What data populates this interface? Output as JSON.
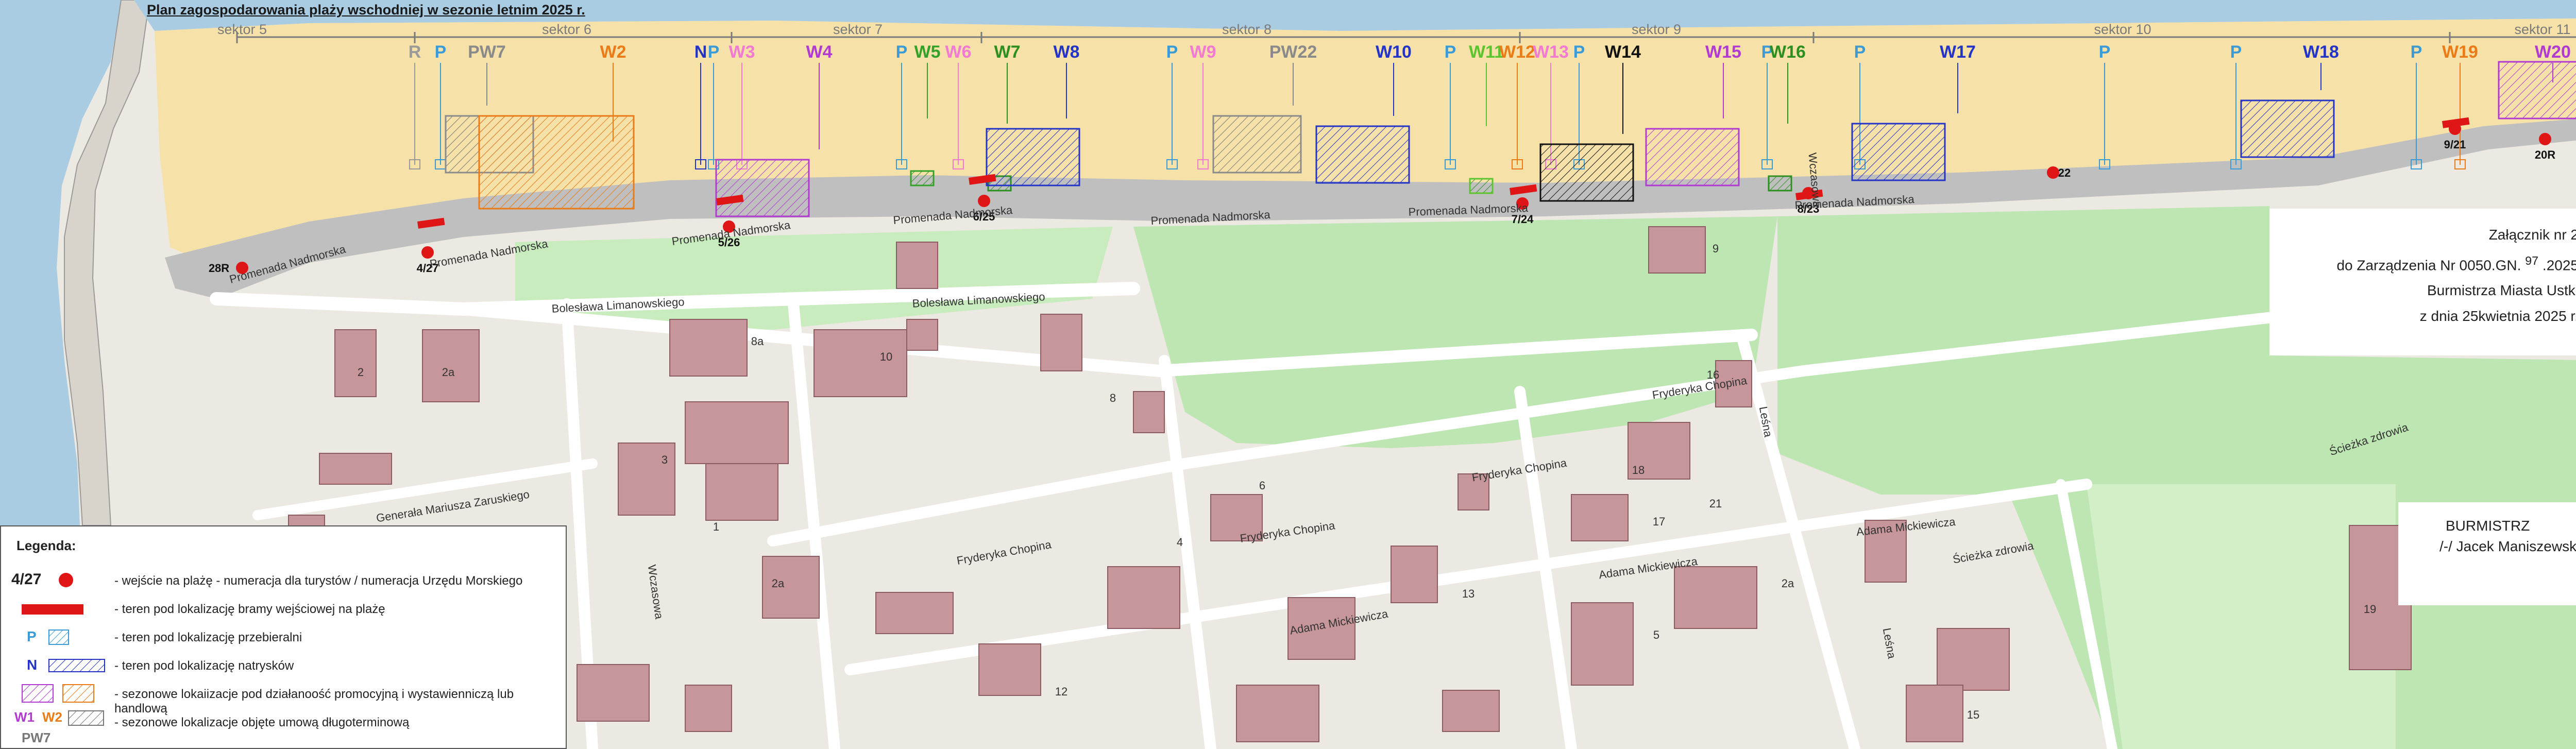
{
  "title": "Plan zagospodarowania plaży wschodniej w sezonie letnim 2025 r.",
  "colors": {
    "sea": "#a9cce3",
    "sand": "#f6e2a9",
    "promenade": "#bfbfbf",
    "park": "#bde6b3",
    "building": "#c6969a",
    "road": "#ffffff",
    "gate": "#e01515",
    "shower": "#2434c6",
    "lifeguard": "#3b9bd6"
  },
  "sectors": [
    "sektor 5",
    "sektor 6",
    "sektor 7",
    "sektor 8",
    "sektor 9",
    "sektor 10",
    "sektor 11"
  ],
  "lots": [
    {
      "label": "R",
      "color": "#9a9a9a",
      "kind": "point"
    },
    {
      "label": "P",
      "color": "#3b9bd6",
      "kind": "point"
    },
    {
      "label": "PW7",
      "color": "#8a8a8a",
      "kind": "long"
    },
    {
      "label": "W2",
      "color": "#ea7b16",
      "kind": "hatch"
    },
    {
      "label": "N",
      "color": "#2434c6",
      "kind": "point"
    },
    {
      "label": "P",
      "color": "#3b9bd6",
      "kind": "point"
    },
    {
      "label": "W3",
      "color": "#f27ad3",
      "kind": "point"
    },
    {
      "label": "W4",
      "color": "#b13ad1",
      "kind": "hatch"
    },
    {
      "label": "P",
      "color": "#3b9bd6",
      "kind": "point"
    },
    {
      "label": "W5",
      "color": "#34a12b",
      "kind": "small"
    },
    {
      "label": "W6",
      "color": "#f27ad3",
      "kind": "point"
    },
    {
      "label": "W7",
      "color": "#2c8f20",
      "kind": "small"
    },
    {
      "label": "W8",
      "color": "#2434c6",
      "kind": "hatch"
    },
    {
      "label": "P",
      "color": "#3b9bd6",
      "kind": "point"
    },
    {
      "label": "W9",
      "color": "#f27ad3",
      "kind": "point"
    },
    {
      "label": "PW22",
      "color": "#8a8a8a",
      "kind": "long"
    },
    {
      "label": "W10",
      "color": "#2434c6",
      "kind": "hatch"
    },
    {
      "label": "P",
      "color": "#3b9bd6",
      "kind": "point"
    },
    {
      "label": "W11",
      "color": "#5cc42e",
      "kind": "small"
    },
    {
      "label": "W12",
      "color": "#ea7b16",
      "kind": "point"
    },
    {
      "label": "W13",
      "color": "#f27ad3",
      "kind": "point"
    },
    {
      "label": "P",
      "color": "#3b9bd6",
      "kind": "point"
    },
    {
      "label": "W14",
      "color": "#111111",
      "kind": "hatch"
    },
    {
      "label": "W15",
      "color": "#b13ad1",
      "kind": "hatch"
    },
    {
      "label": "P",
      "color": "#3b9bd6",
      "kind": "point"
    },
    {
      "label": "W16",
      "color": "#2c8f20",
      "kind": "small"
    },
    {
      "label": "P",
      "color": "#3b9bd6",
      "kind": "point"
    },
    {
      "label": "W17",
      "color": "#2434c6",
      "kind": "hatch"
    },
    {
      "label": "P",
      "color": "#3b9bd6",
      "kind": "point"
    },
    {
      "label": "P",
      "color": "#3b9bd6",
      "kind": "point"
    },
    {
      "label": "W18",
      "color": "#2434c6",
      "kind": "hatch"
    },
    {
      "label": "P",
      "color": "#3b9bd6",
      "kind": "point"
    },
    {
      "label": "W19",
      "color": "#ea7b16",
      "kind": "point"
    },
    {
      "label": "W20",
      "color": "#b13ad1",
      "kind": "hatch"
    },
    {
      "label": "O",
      "color": "#e01515",
      "kind": "point"
    }
  ],
  "entrances": [
    "28R",
    "4/27",
    "5/26",
    "6/25",
    "7/24",
    "8/23",
    "22",
    "9/21",
    "20R"
  ],
  "streets": [
    "Promenada Nadmorska",
    "Promenada Nadmorska",
    "Promenada Nadmorska",
    "Promenada Nadmorska",
    "Promenada Nadmorska",
    "Promenada Nadmorska",
    "Promenada Nadmorska",
    "Bolesława Limanowskiego",
    "Bolesława Limanowskiego",
    "Fryderyka Chopina",
    "Fryderyka Chopina",
    "Fryderyka Chopina",
    "Fryderyka Chopina",
    "Adama Mickiewicza",
    "Adama Mickiewicza",
    "Adama Mickiewicza",
    "Generała Mariusza Zaruskiego",
    "Ścieżka zdrowia",
    "Ścieżka zdrowia",
    "Leśna",
    "Leśna",
    "Wczasowa",
    "Wczasowa"
  ],
  "plots": [
    "2",
    "2a",
    "8a",
    "10",
    "3",
    "1",
    "2a",
    "6",
    "13",
    "16",
    "18",
    "9",
    "2a",
    "8",
    "4",
    "12",
    "19",
    "15",
    "17",
    "21",
    "5"
  ],
  "attachment": {
    "line1": "Załącznik nr 2",
    "line2_prefix": "do Zarządzenia Nr 0050.GN.",
    "line2_num": "97",
    "line2_suffix": ".2025",
    "line3": "Burmistrza Miasta Ustki",
    "line4": "z dnia  25kwietnia 2025 r."
  },
  "signature": {
    "title": "BURMISTRZ",
    "name": "/-/ Jacek Maniszewski"
  },
  "legend": {
    "title": "Legenda:",
    "rows": [
      {
        "symbol": "4/27",
        "text": "- wejście na plażę - numeracja dla turystów / numeracja Urzędu Morskiego"
      },
      {
        "symbol": "",
        "text": "- teren pod lokalizację bramy wejściowej na plażę"
      },
      {
        "symbol": "P",
        "text": "- teren pod lokalizację przebieralni"
      },
      {
        "symbol": "N",
        "text": "- teren pod lokalizację natrysków"
      },
      {
        "symbol": "",
        "text": "- sezonowe lokaiizacje pod działanoość promocyjną i wystawienniczą lub handlową"
      },
      {
        "symbol": "W1 W2",
        "text": "- sezonowe lokalizacje objęte umową długoterminową"
      }
    ],
    "sample_w1": "W1",
    "sample_w2": "W2",
    "sample_pw": "PW7"
  }
}
